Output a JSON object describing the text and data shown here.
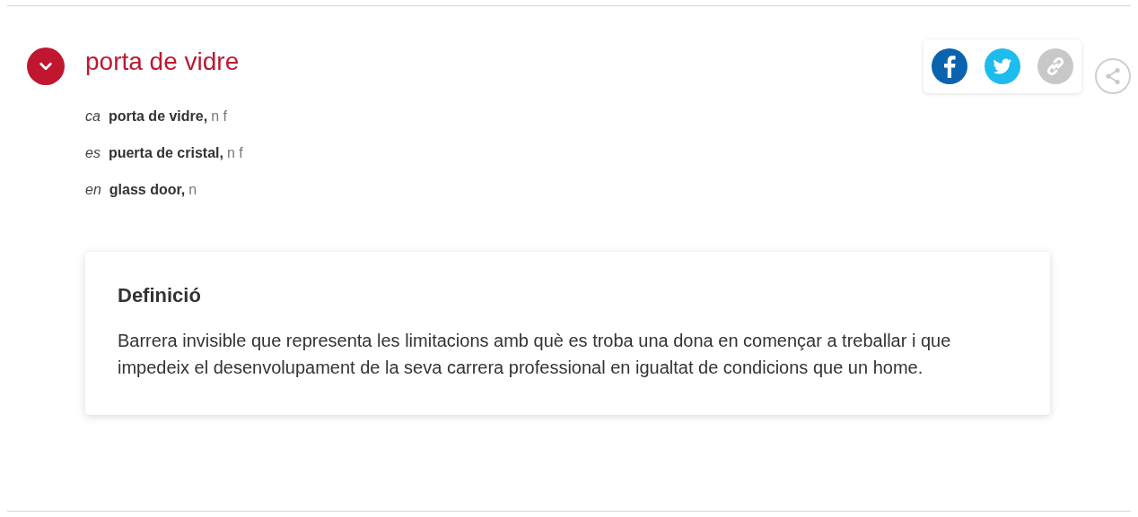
{
  "entry": {
    "expanded": true,
    "title": "porta de vidre"
  },
  "share": [
    {
      "kind": "facebook"
    },
    {
      "kind": "twitter"
    },
    {
      "kind": "link"
    },
    {
      "kind": "share"
    }
  ],
  "terms": [
    {
      "language": "ca",
      "term": "porta de vidre,",
      "grammar": "n f"
    },
    {
      "language": "es",
      "term": "puerta de cristal,",
      "grammar": "n f"
    },
    {
      "language": "en",
      "term": "glass door,",
      "grammar": "n"
    }
  ],
  "definition": {
    "heading": "Definició",
    "text": "Barrera invisible que representa les limitacions amb què es troba una dona en començar a treballar i que impedeix el desenvolupament de la seva carrera professional en igualtat de condicions que un home."
  }
}
